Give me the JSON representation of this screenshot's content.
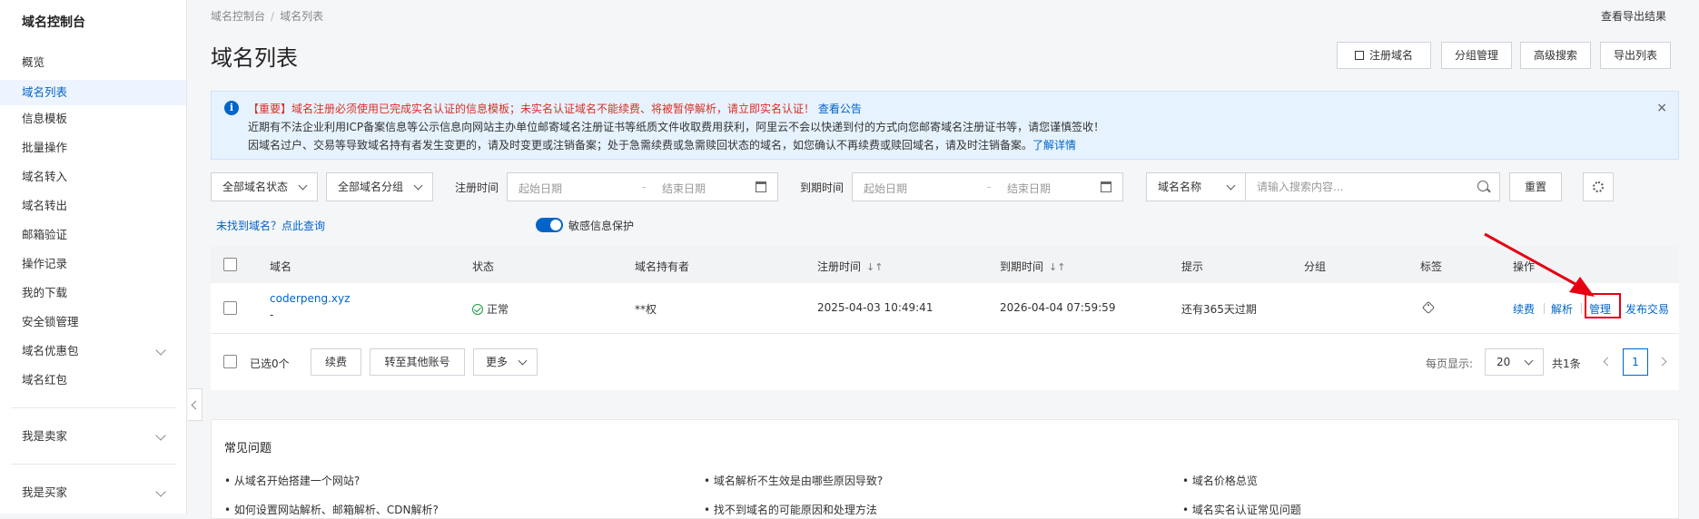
{
  "sidebar": {
    "title": "域名控制台",
    "items": [
      {
        "label": "概览"
      },
      {
        "label": "域名列表"
      },
      {
        "label": "信息模板"
      },
      {
        "label": "批量操作"
      },
      {
        "label": "域名转入"
      },
      {
        "label": "域名转出"
      },
      {
        "label": "邮箱验证"
      },
      {
        "label": "操作记录"
      },
      {
        "label": "我的下载"
      },
      {
        "label": "安全锁管理"
      },
      {
        "label": "域名优惠包"
      },
      {
        "label": "域名红包"
      }
    ],
    "groups": [
      {
        "label": "我是卖家"
      },
      {
        "label": "我是买家"
      }
    ]
  },
  "breadcrumb": {
    "root": "域名控制台",
    "sep": "/",
    "current": "域名列表"
  },
  "header": {
    "title": "域名列表",
    "export_results_link": "查看导出结果",
    "buttons": {
      "register": "注册域名",
      "group_manage": "分组管理",
      "advanced_search": "高级搜索",
      "export_list": "导出列表"
    }
  },
  "notice": {
    "line1_red": "【重要】域名注册必须使用已完成实名认证的信息模板；未实名认证域名不能续费、将被暂停解析，请立即实名认证！",
    "line1_link": "查看公告",
    "line2": "近期有不法企业利用ICP备案信息等公示信息向网站主办单位邮寄域名注册证书等纸质文件收取费用获利，阿里云不会以快递到付的方式向您邮寄域名注册证书等，请您谨慎签收！",
    "line3": "因域名过户、交易等导致域名持有者发生变更的，请及时变更或注销备案；处于急需续费或急需赎回状态的域名，如您确认不再续费或赎回域名，请及时注销备案。",
    "line3_link": "了解详情",
    "close": "×"
  },
  "filters": {
    "status_select": "全部域名状态",
    "group_select": "全部域名分组",
    "reg_time_label": "注册时间",
    "exp_time_label": "到期时间",
    "start_placeholder": "起始日期",
    "end_placeholder": "结束日期",
    "dash": "-",
    "search_type": "域名名称",
    "search_placeholder": "请输入搜索内容...",
    "reset": "重置"
  },
  "helper": {
    "not_found_link": "未找到域名？点此查询",
    "sensitive_toggle_label": "敏感信息保护"
  },
  "table": {
    "headers": {
      "domain": "域名",
      "status": "状态",
      "holder": "域名持有者",
      "reg_time": "注册时间",
      "exp_time": "到期时间",
      "tip": "提示",
      "group": "分组",
      "tag": "标签",
      "ops": "操作"
    },
    "sort_glyph": "↓↑",
    "rows": [
      {
        "domain": "coderpeng.xyz",
        "sub": "-",
        "status": "正常",
        "holder": "**权",
        "reg_time": "2025-04-03 10:49:41",
        "exp_time": "2026-04-04 07:59:59",
        "tip": "还有365天过期"
      }
    ],
    "ops": {
      "renew": "续费",
      "resolve": "解析",
      "manage": "管理",
      "trade": "发布交易"
    }
  },
  "bottombar": {
    "selected": "已选0个",
    "renew": "续费",
    "transfer": "转至其他账号",
    "more": "更多",
    "page_size_label": "每页显示:",
    "page_size": "20",
    "total": "共1条",
    "current_page": "1"
  },
  "faq": {
    "title": "常见问题",
    "items": [
      "• 从域名开始搭建一个网站?",
      "• 域名解析不生效是由哪些原因导致?",
      "• 域名价格总览",
      "• 如何设置网站解析、邮箱解析、CDN解析?",
      "• 找不到域名的可能原因和处理方法",
      "• 域名实名认证常见问题"
    ]
  },
  "colors": {
    "accent": "#0064c8",
    "alert_red": "#e60012",
    "ok_green": "#1e9b3d"
  }
}
